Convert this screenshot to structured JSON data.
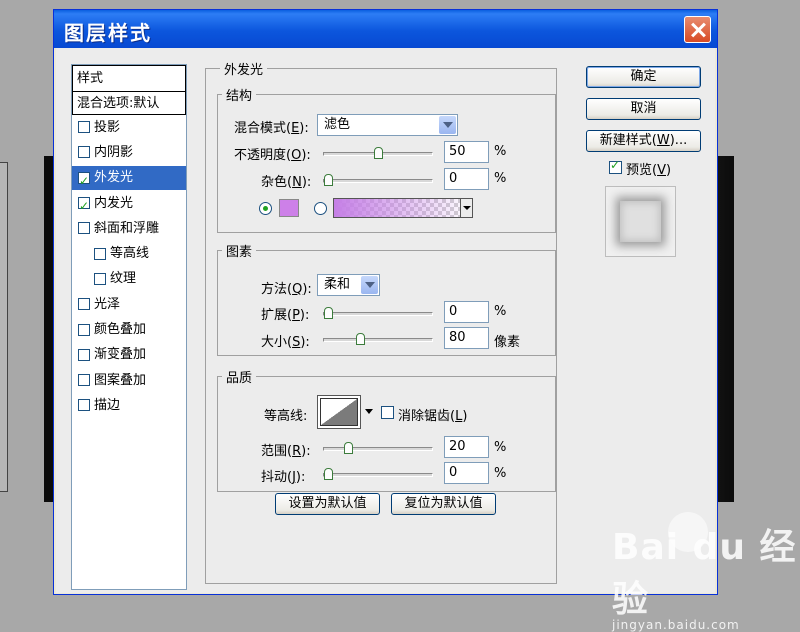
{
  "window": {
    "title": "图层样式"
  },
  "left_list": {
    "header": "样式",
    "blend_options": "混合选项:默认",
    "items": [
      {
        "label": "投影",
        "checked": false,
        "sub": false,
        "selected": false
      },
      {
        "label": "内阴影",
        "checked": false,
        "sub": false,
        "selected": false
      },
      {
        "label": "外发光",
        "checked": true,
        "sub": false,
        "selected": true
      },
      {
        "label": "内发光",
        "checked": true,
        "sub": false,
        "selected": false
      },
      {
        "label": "斜面和浮雕",
        "checked": false,
        "sub": false,
        "selected": false
      },
      {
        "label": "等高线",
        "checked": false,
        "sub": true,
        "selected": false
      },
      {
        "label": "纹理",
        "checked": false,
        "sub": true,
        "selected": false
      },
      {
        "label": "光泽",
        "checked": false,
        "sub": false,
        "selected": false
      },
      {
        "label": "颜色叠加",
        "checked": false,
        "sub": false,
        "selected": false
      },
      {
        "label": "渐变叠加",
        "checked": false,
        "sub": false,
        "selected": false
      },
      {
        "label": "图案叠加",
        "checked": false,
        "sub": false,
        "selected": false
      },
      {
        "label": "描边",
        "checked": false,
        "sub": false,
        "selected": false
      }
    ]
  },
  "outer_glow": {
    "title": "外发光",
    "structure": {
      "title": "结构",
      "blend_mode_label": "混合模式(",
      "blend_mode_key": "E",
      "blend_mode_value": "滤色",
      "opacity_label": "不透明度(",
      "opacity_key": "O",
      "opacity_value": "50",
      "opacity_unit": "%",
      "opacity_level": 0.5,
      "noise_label": "杂色(",
      "noise_key": "N",
      "noise_value": "0",
      "noise_unit": "%",
      "noise_level": 0,
      "glow_color": "#cd80e8"
    },
    "elements": {
      "title": "图素",
      "technique_label": "方法(",
      "technique_key": "Q",
      "technique_value": "柔和",
      "spread_label": "扩展(",
      "spread_key": "P",
      "spread_value": "0",
      "spread_unit": "%",
      "spread_level": 0,
      "size_label": "大小(",
      "size_key": "S",
      "size_value": "80",
      "size_unit": "像素",
      "size_level": 0.32
    },
    "quality": {
      "title": "品质",
      "contour_label": "等高线:",
      "antialias_label": "消除锯齿(",
      "antialias_key": "L",
      "antialias_checked": false,
      "range_label": "范围(",
      "range_key": "R",
      "range_value": "20",
      "range_unit": "%",
      "range_level": 0.2,
      "jitter_label": "抖动(",
      "jitter_key": "J",
      "jitter_value": "0",
      "jitter_unit": "%",
      "jitter_level": 0
    },
    "set_default": "设置为默认值",
    "reset_default": "复位为默认值"
  },
  "buttons": {
    "ok": "确定",
    "cancel": "取消",
    "new_style_prefix": "新建样式(",
    "new_style_key": "W",
    "new_style_suffix": ")...",
    "preview_label": "预览(",
    "preview_key": "V",
    "preview_checked": true
  },
  "watermark": {
    "logo": "Bai du 经验",
    "url": "jingyan.baidu.com"
  }
}
